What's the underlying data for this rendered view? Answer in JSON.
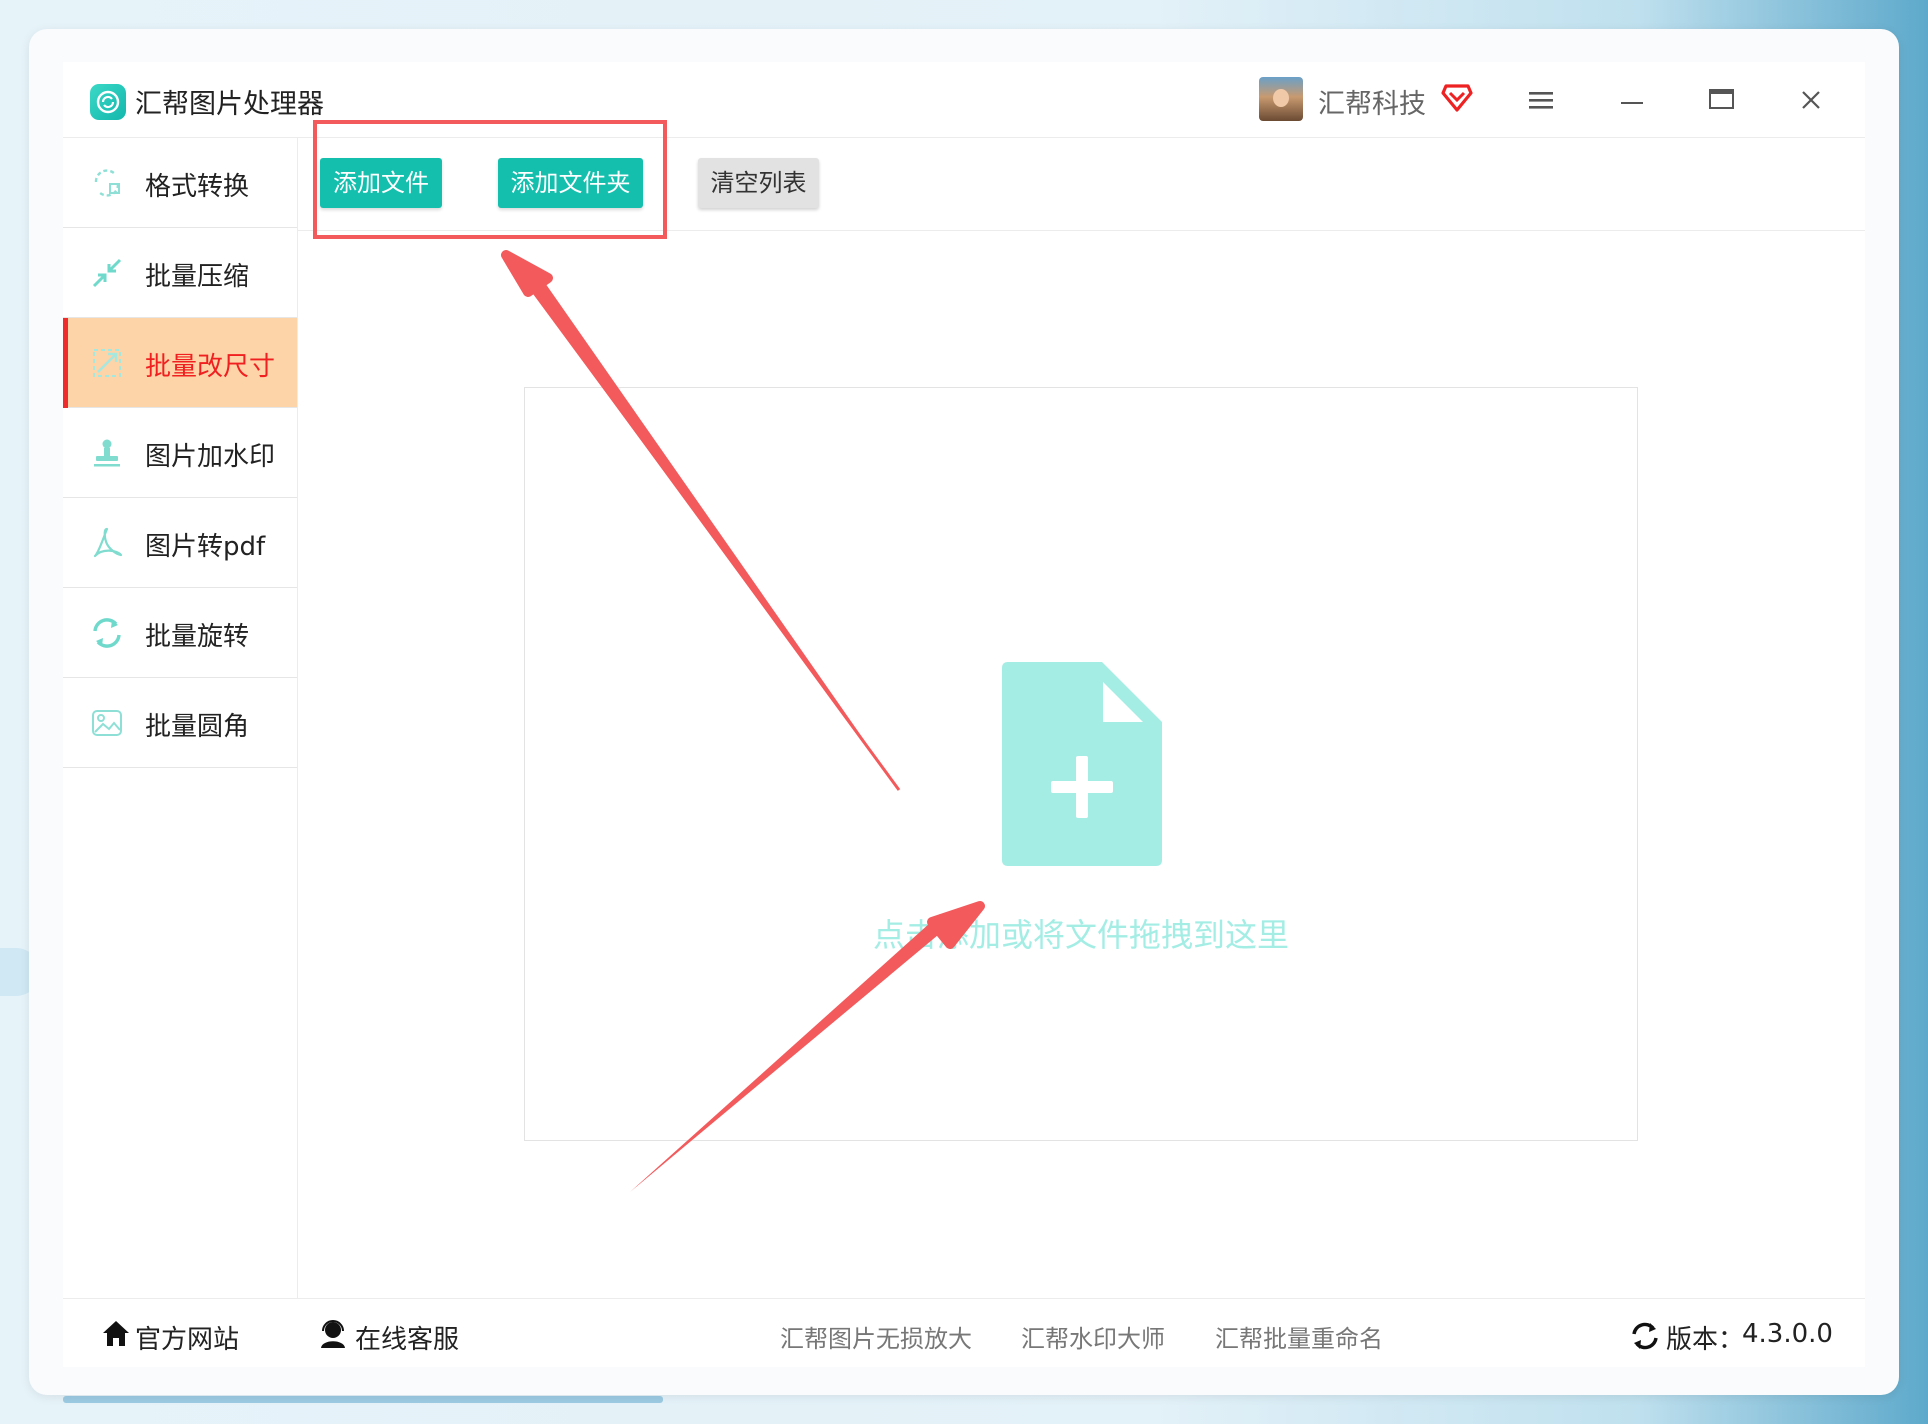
{
  "app": {
    "title": "汇帮图片处理器",
    "username": "汇帮科技",
    "icons": {
      "logo": "app-logo-icon",
      "vip": "vip-diamond-icon",
      "menu": "hamburger-menu-icon",
      "minimize": "minimize-icon",
      "maximize": "maximize-icon",
      "close": "close-icon"
    }
  },
  "sidebar": {
    "items": [
      {
        "label": "格式转换",
        "icon": "format-convert-icon",
        "active": false
      },
      {
        "label": "批量压缩",
        "icon": "compress-icon",
        "active": false
      },
      {
        "label": "批量改尺寸",
        "icon": "resize-icon",
        "active": true
      },
      {
        "label": "图片加水印",
        "icon": "watermark-stamp-icon",
        "active": false
      },
      {
        "label": "图片转pdf",
        "icon": "pdf-icon",
        "active": false
      },
      {
        "label": "批量旋转",
        "icon": "rotate-icon",
        "active": false
      },
      {
        "label": "批量圆角",
        "icon": "image-rounded-icon",
        "active": false
      }
    ]
  },
  "toolbar": {
    "add_file": "添加文件",
    "add_folder": "添加文件夹",
    "clear_list": "清空列表"
  },
  "dropzone": {
    "text": "点击添加或将文件拖拽到这里",
    "icon": "file-add-icon"
  },
  "footer": {
    "website": "官方网站",
    "support": "在线客服",
    "links": [
      "汇帮图片无损放大",
      "汇帮水印大师",
      "汇帮批量重命名"
    ],
    "version_label": "版本：",
    "version": "4.3.0.0"
  },
  "colors": {
    "accent": "#14bfae",
    "active_bg": "#fdd3a8",
    "active_text": "#f02020",
    "annotation": "#f25a5c",
    "drop_icon": "#a4ede5"
  }
}
